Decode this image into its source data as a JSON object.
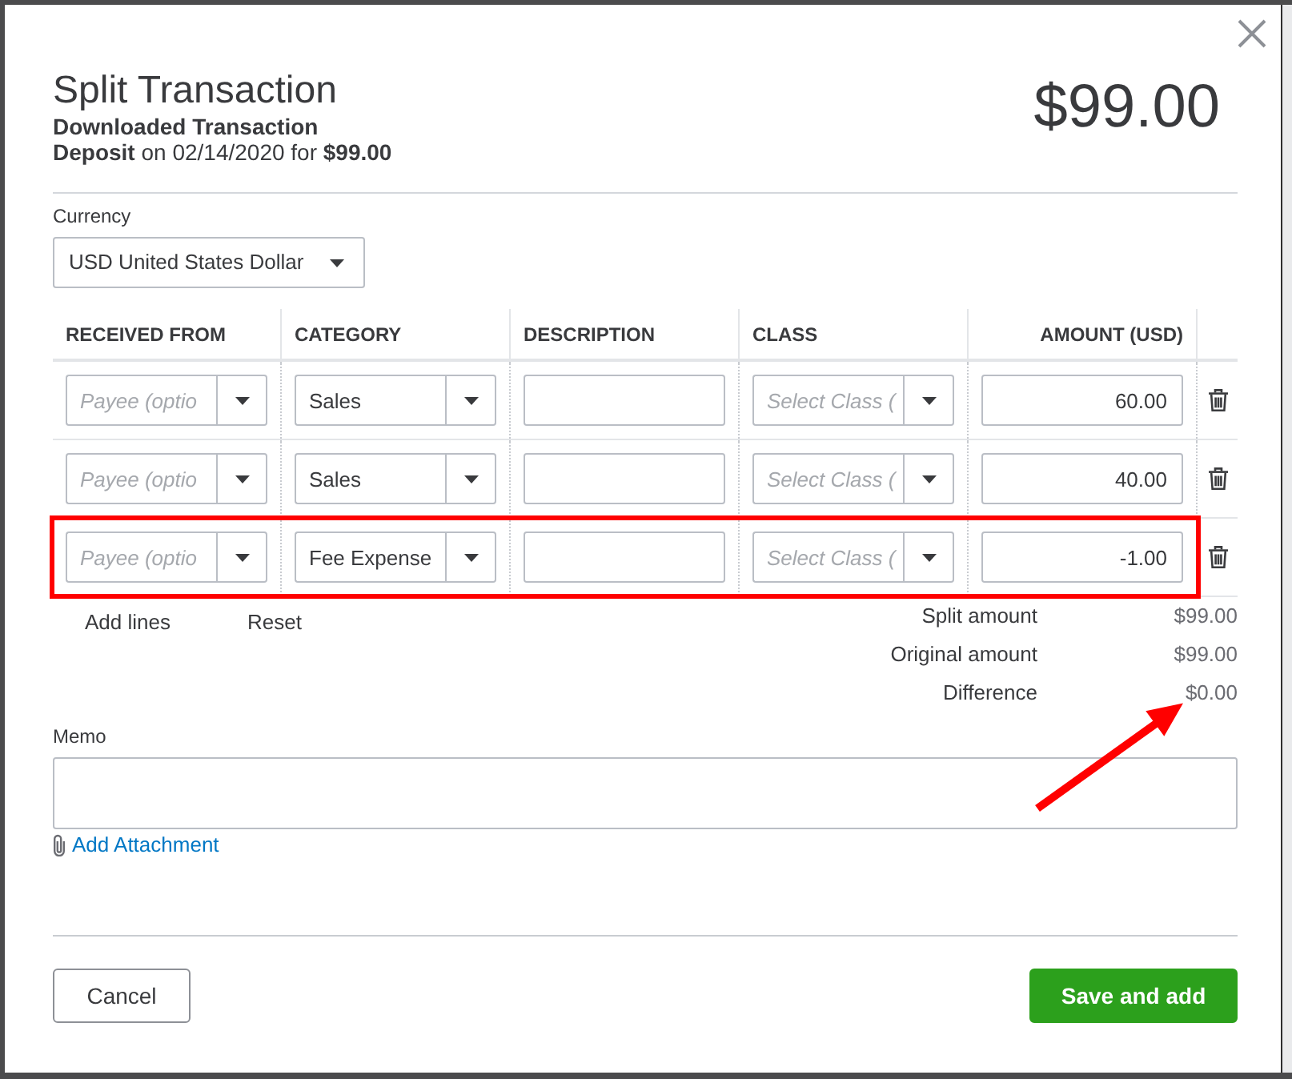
{
  "header": {
    "title": "Split Transaction",
    "subtitle": "Downloaded Transaction",
    "details": "**Deposit** on 02/14/2020 for **$99.00**",
    "amount": "$99.00"
  },
  "currency": {
    "label": "Currency",
    "value": "USD United States Dollar"
  },
  "table": {
    "columns": [
      "RECEIVED FROM",
      "CATEGORY",
      "DESCRIPTION",
      "CLASS",
      "AMOUNT (USD)"
    ],
    "rows": [
      {
        "received_from": {
          "placeholder": "Payee (optio"
        },
        "category": {
          "value": "Sales"
        },
        "class": {
          "placeholder": "Select Class ("
        },
        "amount": "60.00",
        "highlighted": false
      },
      {
        "received_from": {
          "placeholder": "Payee (optio"
        },
        "category": {
          "value": "Sales"
        },
        "class": {
          "placeholder": "Select Class ("
        },
        "amount": "40.00",
        "highlighted": false
      },
      {
        "received_from": {
          "placeholder": "Payee (optio"
        },
        "category": {
          "value": "Fee Expense"
        },
        "class": {
          "placeholder": "Select Class ("
        },
        "amount": "-1.00",
        "highlighted": true
      }
    ]
  },
  "line_actions": [
    "Add lines",
    "Reset"
  ],
  "totals": [
    {
      "label": "Split amount",
      "value": "$99.00"
    },
    {
      "label": "Original amount",
      "value": "$99.00"
    },
    {
      "label": "Difference",
      "value": "$0.00"
    }
  ],
  "memo": {
    "label": "Memo"
  },
  "attachment_link": "Add Attachment",
  "buttons": [
    {
      "label": "Cancel",
      "kind": "secondary"
    },
    {
      "label": "Save and add",
      "kind": "primary"
    }
  ]
}
